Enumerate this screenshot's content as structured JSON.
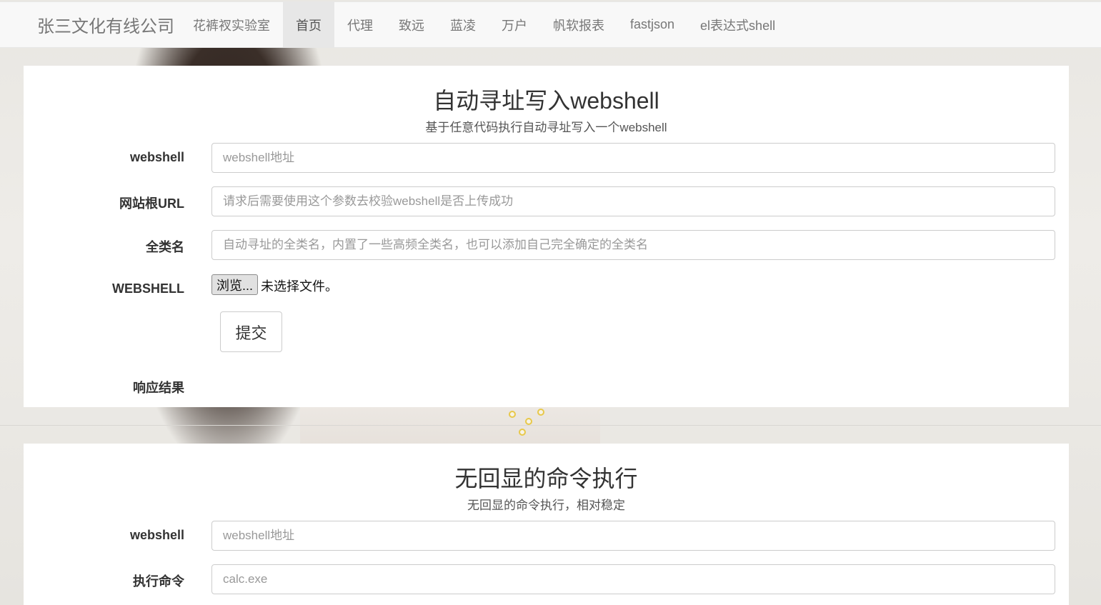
{
  "navbar": {
    "brand": "张三文化有线公司",
    "items": [
      {
        "label": "花裤衩实验室"
      },
      {
        "label": "首页",
        "active": true
      },
      {
        "label": "代理"
      },
      {
        "label": "致远"
      },
      {
        "label": "蓝凌"
      },
      {
        "label": "万户"
      },
      {
        "label": "帆软报表"
      },
      {
        "label": "fastjson"
      },
      {
        "label": "el表达式shell"
      }
    ]
  },
  "panel1": {
    "title": "自动寻址写入webshell",
    "subtitle": "基于任意代码执行自动寻址写入一个webshell",
    "webshell_label": "webshell",
    "webshell_placeholder": "webshell地址",
    "root_url_label": "网站根URL",
    "root_url_placeholder": "请求后需要使用这个参数去校验webshell是否上传成功",
    "class_label": "全类名",
    "class_placeholder": "自动寻址的全类名，内置了一些高频全类名，也可以添加自己完全确定的全类名",
    "file_label": "WEBSHELL",
    "file_button": "浏览...",
    "file_status": "未选择文件。",
    "submit_label": "提交",
    "response_label": "响应结果"
  },
  "panel2": {
    "title": "无回显的命令执行",
    "subtitle": "无回显的命令执行，相对稳定",
    "webshell_label": "webshell",
    "webshell_placeholder": "webshell地址",
    "command_label": "执行命令",
    "command_placeholder": "calc.exe"
  }
}
